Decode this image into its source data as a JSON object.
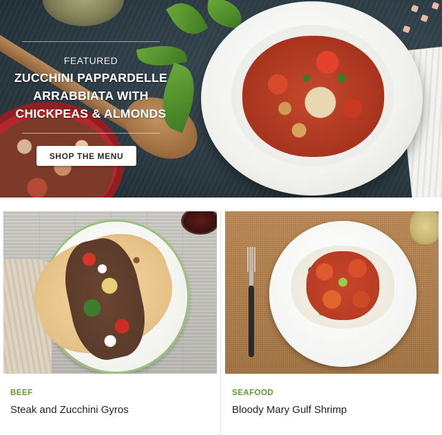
{
  "hero": {
    "eyebrow": "FEATURED",
    "title_line1": "ZUCCHINI PAPPARDELLE",
    "title_line2": "ARRABBIATA WITH",
    "title_line3": "CHICKPEAS & ALMONDS",
    "cta_label": "SHOP THE MENU"
  },
  "cards": [
    {
      "category": "BEEF",
      "title": "Steak and Zucchini Gyros"
    },
    {
      "category": "SEAFOOD",
      "title": "Bloody Mary Gulf Shrimp"
    }
  ],
  "colors": {
    "category_green": "#5e9a2c",
    "hero_background": "#2c3b44",
    "cta_background": "#ffffff"
  }
}
